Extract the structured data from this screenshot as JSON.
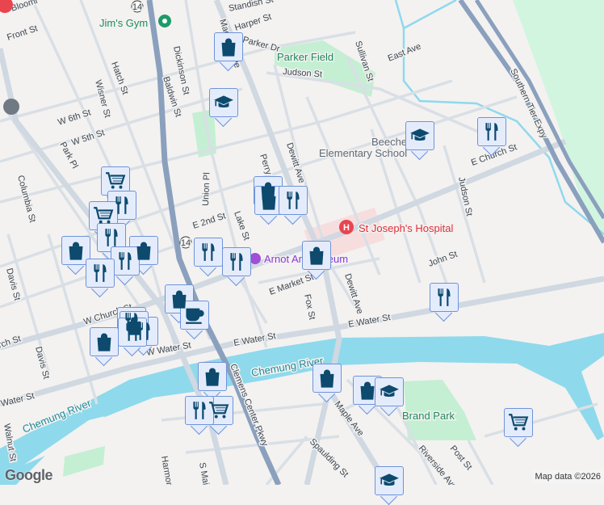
{
  "streets": {
    "front": "Front St",
    "hatch": "Hatch St",
    "wisner": "Wisner St",
    "w6th": "W 6th St",
    "w5th": "W 5th St",
    "park_pl": "Park Pl",
    "columbia": "Columbia St",
    "davis": "Davis St",
    "baldwin": "Baldwin St",
    "dickinson": "Dickinson St",
    "union": "Union Pl",
    "lake": "Lake St",
    "e2nd": "E 2nd St",
    "perry": "Perry St",
    "madison": "Madison Ave",
    "dewitt": "Dewitt Ave",
    "harper": "Harper St",
    "parker_dr": "Parker Dr",
    "standish": "Standish St",
    "judson_st": "Judson St",
    "sullivan": "Sullivan St",
    "east_ave": "East Ave",
    "e_church": "E Church St",
    "w_church": "W Church St",
    "judson": "Judson St",
    "john": "John St",
    "e_market": "E Market St",
    "fox": "Fox St",
    "e_water": "E Water St",
    "w_water": "W Water St",
    "water": "Water St",
    "clemens": "Clemens Center Pkwy",
    "maple": "Maple Ave",
    "spaulding": "Spaulding St",
    "riverside": "Riverside Ave",
    "post": "Post St",
    "harmon": "Harmon St",
    "s_main": "S Main St",
    "walnut": "Walnut St",
    "southern_tier": "Southern Tier Expy",
    "church_w_edge": "Church St",
    "blooming": "Bloomi",
    "route14": "14"
  },
  "pois": {
    "jims_gym": "Jim's Gym",
    "parker_field": "Parker Field",
    "beecher": "Beecher",
    "beecher2": "Elementary School",
    "hospital": "St Joseph's Hospital",
    "arnot": "Arnot Art Museum",
    "chemung1": "Chemung River",
    "chemung2": "Chemung River",
    "brand_park": "Brand Park"
  },
  "footer": {
    "google_logo": "Google",
    "attribution": "Map data ©2026"
  },
  "colors": {
    "water": "#8fd9ec",
    "park": "#c4efd3",
    "road": "#d5dde5",
    "highway": "#8aa0bd",
    "marker_icon": "#0d4a6e"
  }
}
